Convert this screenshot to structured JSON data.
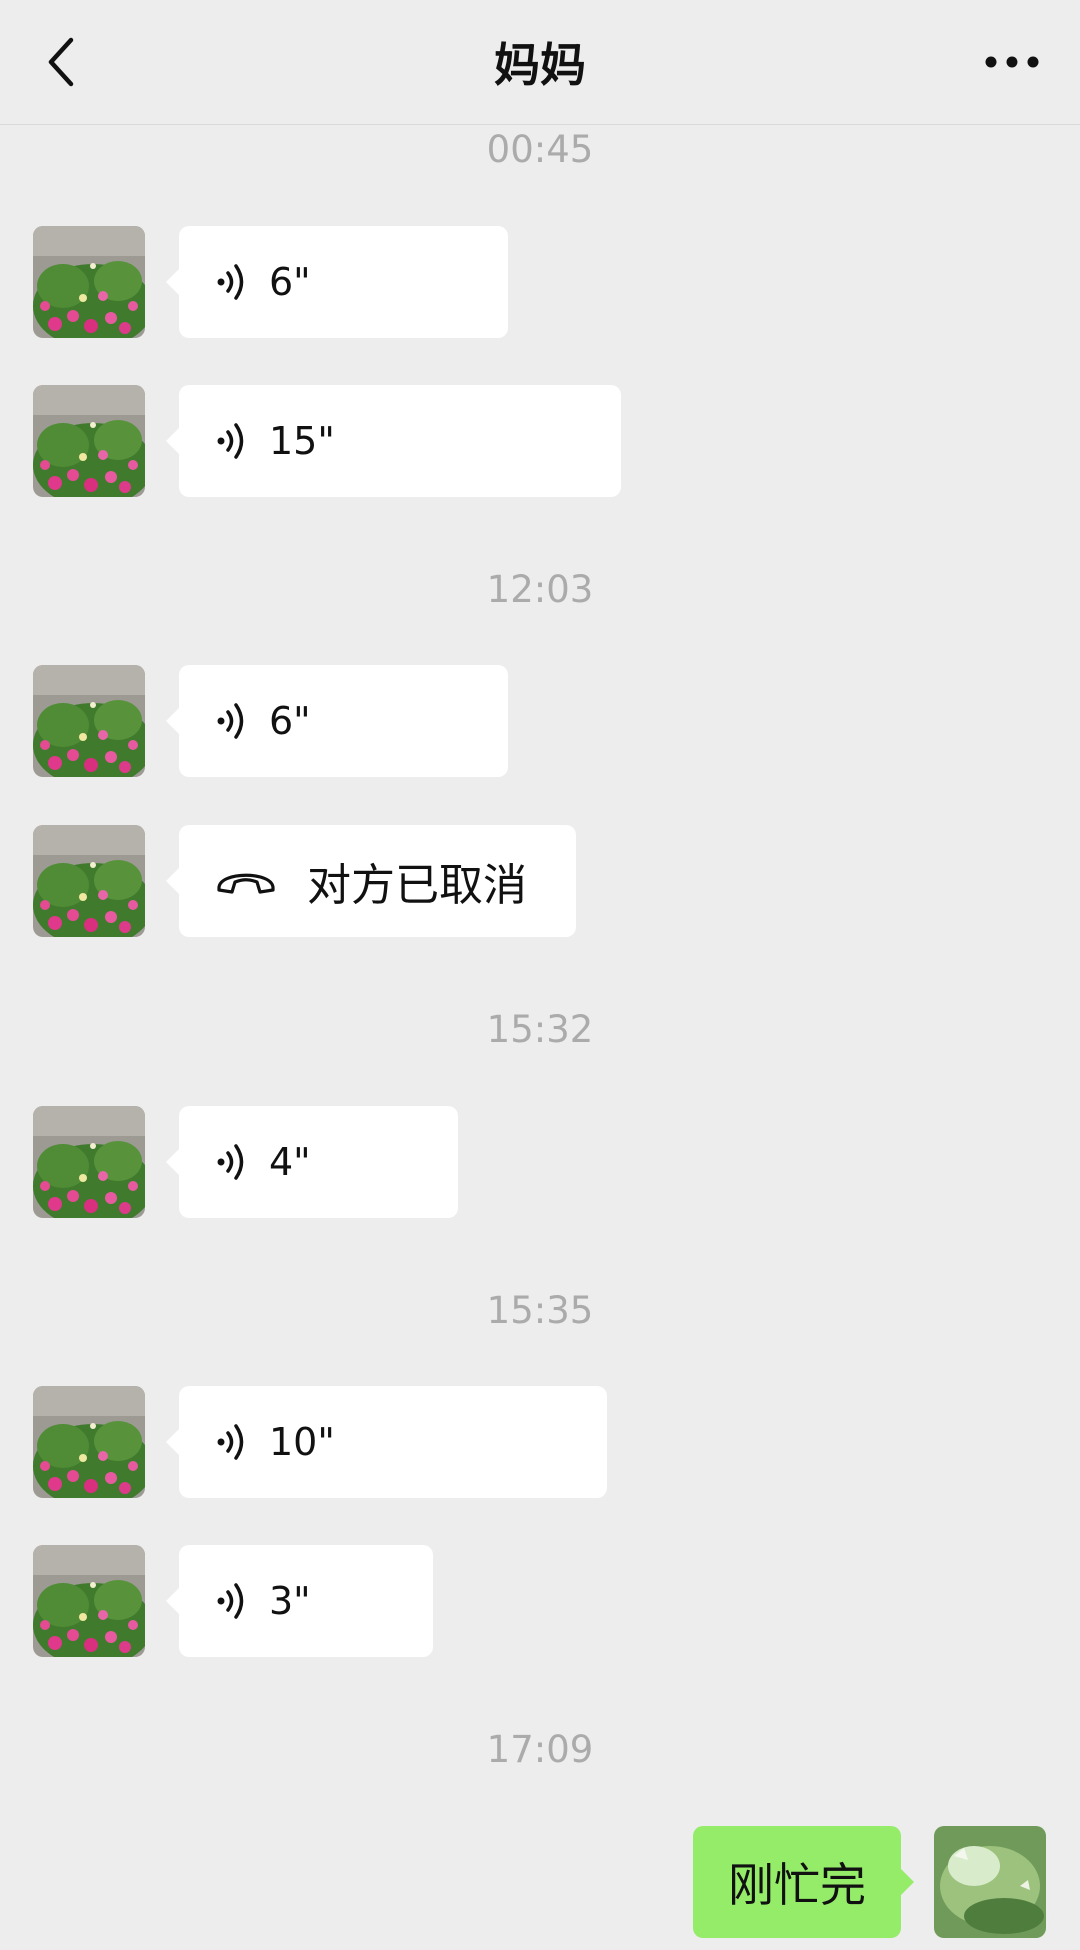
{
  "header": {
    "title": "妈妈"
  },
  "messages": [
    {
      "type": "time",
      "text": "00:45"
    },
    {
      "type": "voice",
      "duration": "6\""
    },
    {
      "type": "voice",
      "duration": "15\""
    },
    {
      "type": "time",
      "text": "12:03"
    },
    {
      "type": "voice",
      "duration": "6\""
    },
    {
      "type": "call",
      "text": "对方已取消"
    },
    {
      "type": "time",
      "text": "15:32"
    },
    {
      "type": "voice",
      "duration": "4\""
    },
    {
      "type": "time",
      "text": "15:35"
    },
    {
      "type": "voice",
      "duration": "10\""
    },
    {
      "type": "voice",
      "duration": "3\""
    },
    {
      "type": "time",
      "text": "17:09"
    },
    {
      "type": "text",
      "from": "me",
      "text": "刚忙完"
    }
  ],
  "colors": {
    "background": "#ededed",
    "incoming_bubble": "#ffffff",
    "outgoing_bubble": "#95ec69",
    "timestamp": "#ababab"
  },
  "icons": {
    "back": "chevron-left-icon",
    "more": "more-horizontal-icon",
    "voice": "voice-wave-icon",
    "call": "phone-hangup-icon"
  }
}
